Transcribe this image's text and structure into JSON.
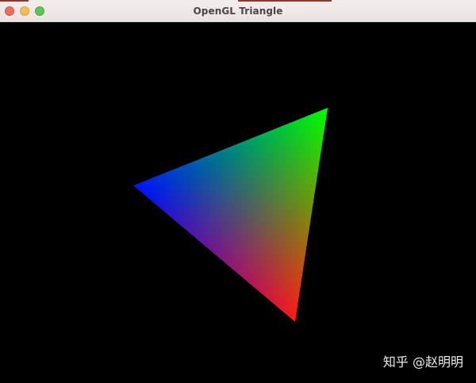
{
  "window": {
    "title": "OpenGL Triangle",
    "buttons": {
      "close": "close-icon",
      "minimize": "minimize-icon",
      "zoom": "zoom-icon"
    }
  },
  "viewport": {
    "background": "#000000",
    "triangle": {
      "vertex_colors": [
        "#ff0000",
        "#00ff00",
        "#0000ff"
      ]
    }
  },
  "watermark": {
    "text": "知乎 @赵明明"
  }
}
